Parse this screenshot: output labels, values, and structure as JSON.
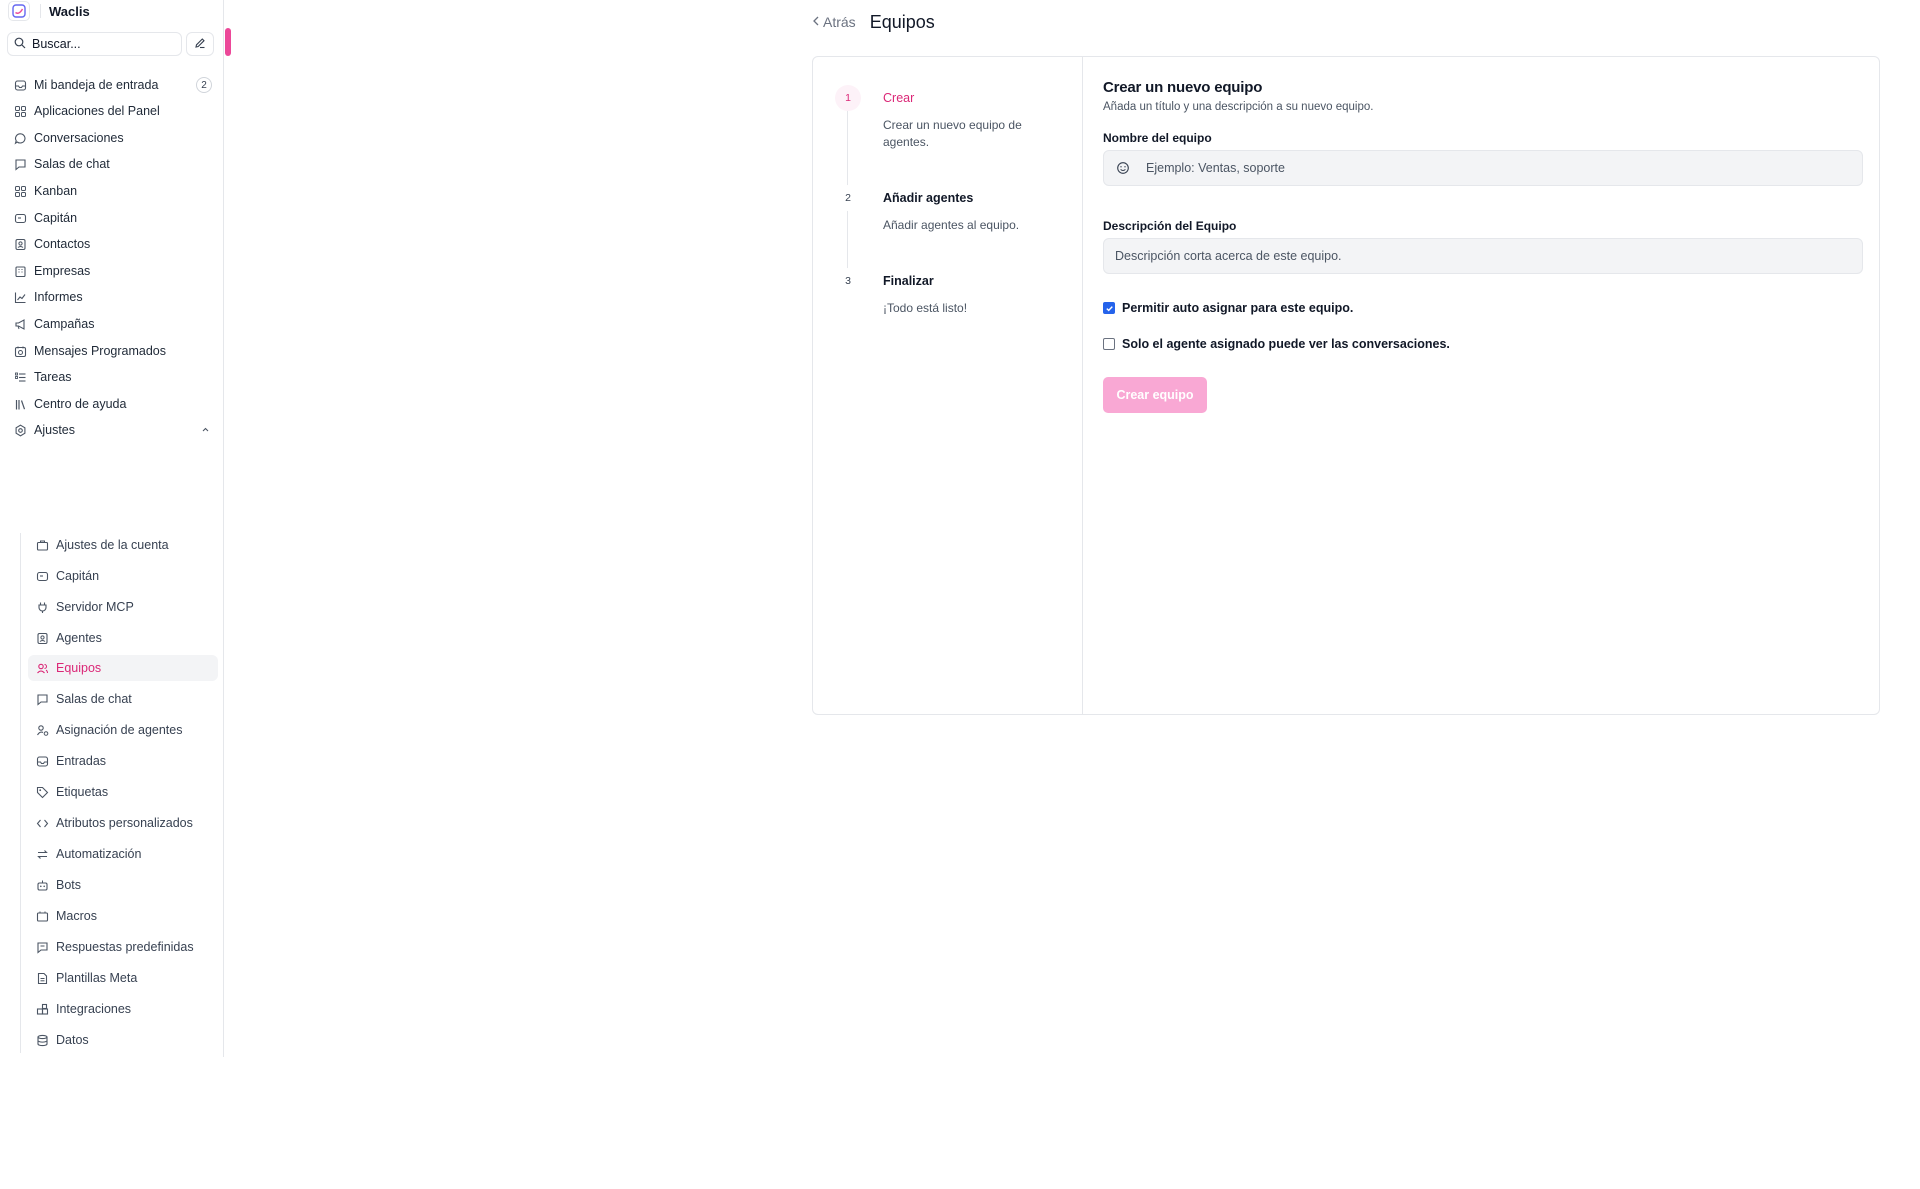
{
  "app": {
    "name": "Waclis"
  },
  "search": {
    "placeholder": "Buscar..."
  },
  "nav": {
    "items": [
      {
        "label": "Mi bandeja de entrada",
        "badge": "2",
        "icon": "inbox-icon"
      },
      {
        "label": "Aplicaciones del Panel",
        "icon": "grid-icon"
      },
      {
        "label": "Conversaciones",
        "icon": "chat-bubble-icon"
      },
      {
        "label": "Salas de chat",
        "icon": "chat-square-icon"
      },
      {
        "label": "Kanban",
        "icon": "kanban-icon"
      },
      {
        "label": "Capitán",
        "icon": "captain-icon"
      },
      {
        "label": "Contactos",
        "icon": "contact-card-icon"
      },
      {
        "label": "Empresas",
        "icon": "building-icon"
      },
      {
        "label": "Informes",
        "icon": "chart-line-icon"
      },
      {
        "label": "Campañas",
        "icon": "megaphone-icon"
      },
      {
        "label": "Mensajes Programados",
        "icon": "calendar-clock-icon"
      },
      {
        "label": "Tareas",
        "icon": "tasks-icon"
      },
      {
        "label": "Centro de ayuda",
        "icon": "library-icon"
      },
      {
        "label": "Ajustes",
        "icon": "settings-icon"
      }
    ],
    "settings_items": [
      {
        "label": "Ajustes de la cuenta",
        "icon": "briefcase-icon"
      },
      {
        "label": "Capitán",
        "icon": "captain-icon"
      },
      {
        "label": "Servidor MCP",
        "icon": "plug-icon"
      },
      {
        "label": "Agentes",
        "icon": "agent-icon"
      },
      {
        "label": "Equipos",
        "icon": "users-icon",
        "active": true
      },
      {
        "label": "Salas de chat",
        "icon": "chat-square-icon"
      },
      {
        "label": "Asignación de agentes",
        "icon": "user-assign-icon"
      },
      {
        "label": "Entradas",
        "icon": "inbox-icon"
      },
      {
        "label": "Etiquetas",
        "icon": "tag-icon"
      },
      {
        "label": "Atributos personalizados",
        "icon": "code-icon"
      },
      {
        "label": "Automatización",
        "icon": "automation-icon"
      },
      {
        "label": "Bots",
        "icon": "bot-icon"
      },
      {
        "label": "Macros",
        "icon": "macro-icon"
      },
      {
        "label": "Respuestas predefinidas",
        "icon": "canned-response-icon"
      },
      {
        "label": "Plantillas Meta",
        "icon": "document-icon"
      },
      {
        "label": "Integraciones",
        "icon": "integrations-icon"
      },
      {
        "label": "Datos",
        "icon": "database-icon"
      }
    ]
  },
  "header": {
    "back_label": "Atrás",
    "title": "Equipos"
  },
  "steps": [
    {
      "number": "1",
      "title": "Crear",
      "description": "Crear un nuevo equipo de agentes.",
      "active": true
    },
    {
      "number": "2",
      "title": "Añadir agentes",
      "description": "Añadir agentes al equipo."
    },
    {
      "number": "3",
      "title": "Finalizar",
      "description": "¡Todo está listo!"
    }
  ],
  "form": {
    "title": "Crear un nuevo equipo",
    "subtitle": "Añada un título y una descripción a su nuevo equipo.",
    "name_label": "Nombre del equipo",
    "name_placeholder": "Ejemplo: Ventas, soporte",
    "description_label": "Descripción del Equipo",
    "description_placeholder": "Descripción corta acerca de este equipo.",
    "auto_assign_label": "Permitir auto asignar para este equipo.",
    "auto_assign_checked": true,
    "assigned_only_label": "Solo el agente asignado puede ver las conversaciones.",
    "assigned_only_checked": false,
    "submit_label": "Crear equipo"
  },
  "colors": {
    "accent": "#db2777",
    "accent_disabled": "#f9a8d4",
    "checkbox": "#2563eb"
  }
}
